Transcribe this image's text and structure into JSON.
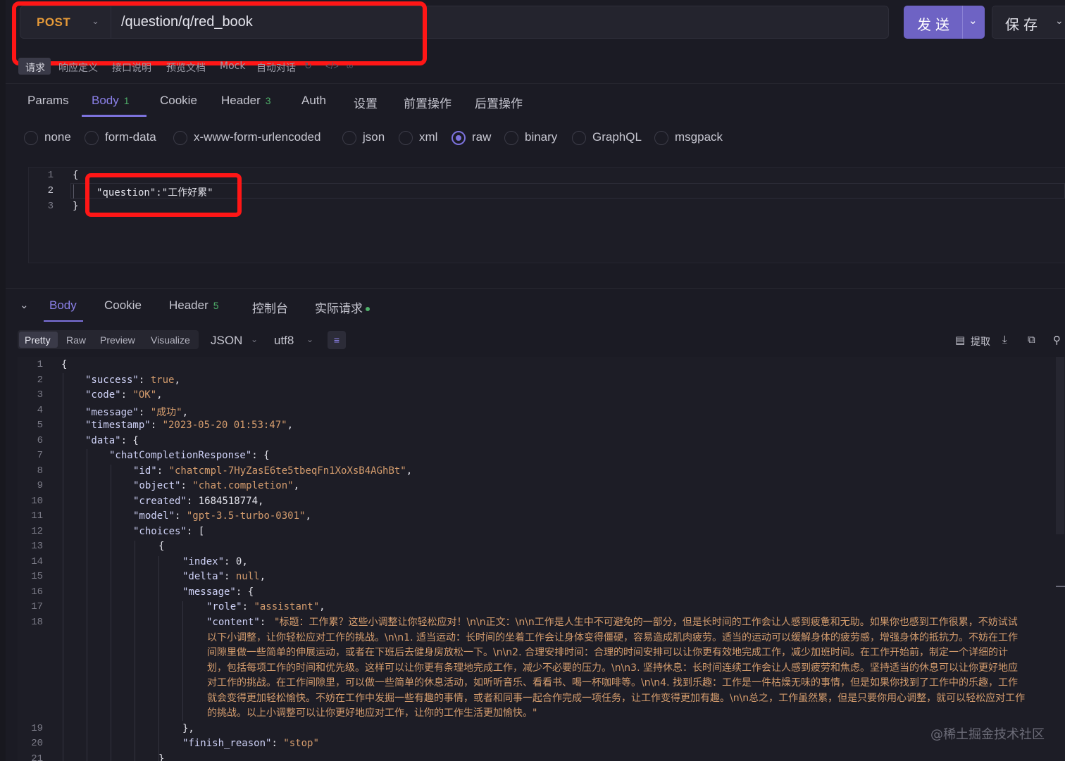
{
  "request": {
    "method": "POST",
    "url": "/question/q/red_book",
    "send_label": "发送",
    "save_label": "保存"
  },
  "sub_tabs": [
    "请求",
    "响应定义",
    "接口说明",
    "预览文档",
    "Mock",
    "自动对话"
  ],
  "request_tabs": [
    {
      "label": "Params",
      "badge": ""
    },
    {
      "label": "Body",
      "badge": "1"
    },
    {
      "label": "Cookie",
      "badge": ""
    },
    {
      "label": "Header",
      "badge": "3"
    },
    {
      "label": "Auth",
      "badge": ""
    },
    {
      "label": "设置",
      "badge": ""
    },
    {
      "label": "前置操作",
      "badge": ""
    },
    {
      "label": "后置操作",
      "badge": ""
    }
  ],
  "body_types": [
    "none",
    "form-data",
    "x-www-form-urlencoded",
    "json",
    "xml",
    "raw",
    "binary",
    "GraphQL",
    "msgpack"
  ],
  "body_type_selected": "raw",
  "request_body_lines": [
    "{",
    "\"question\":\"工作好累\"",
    "}"
  ],
  "response_tabs": [
    {
      "label": "Body",
      "badge": ""
    },
    {
      "label": "Cookie",
      "badge": ""
    },
    {
      "label": "Header",
      "badge": "5"
    },
    {
      "label": "控制台",
      "badge": ""
    },
    {
      "label": "实际请求",
      "badge": ""
    }
  ],
  "view_modes": [
    "Pretty",
    "Raw",
    "Preview",
    "Visualize"
  ],
  "format": "JSON",
  "encoding": "utf8",
  "extract_label": "提取",
  "response": {
    "success": "true",
    "code": "\"OK\"",
    "message": "\"成功\"",
    "timestamp": "\"2023-05-20 01:53:47\"",
    "id": "\"chatcmpl-7HyZasE6te5tbeqFn1XoXsB4AGhBt\"",
    "object": "\"chat.completion\"",
    "created": "1684518774",
    "model": "\"gpt-3.5-turbo-0301\"",
    "index": "0",
    "delta": "null",
    "role": "\"assistant\"",
    "content_lines": [
      "\"标题：工作累？这些小调整让你轻松应对！\\n\\n正文：\\n\\n工作是人生中不可避免的一部分，但是长时间的工作会让人感到疲惫和无助。如果你也感到工作很累，不妨试试",
      "以下小调整，让你轻松应对工作的挑战。\\n\\n1. 适当运动：长时间的坐着工作会让身体变得僵硬，容易造成肌肉疲劳。适当的运动可以缓解身体的疲劳感，增强身体的抵抗力。不妨在工作",
      "间隙里做一些简单的伸展运动，或者在下班后去健身房放松一下。\\n\\n2. 合理安排时间：合理的时间安排可以让你更有效地完成工作，减少加班时间。在工作开始前，制定一个详细的计",
      "划，包括每项工作的时间和优先级。这样可以让你更有条理地完成工作，减少不必要的压力。\\n\\n3. 坚持休息：长时间连续工作会让人感到疲劳和焦虑。坚持适当的休息可以让你更好地应",
      "对工作的挑战。在工作间隙里，可以做一些简单的休息活动，如听听音乐、看看书、喝一杯咖啡等。\\n\\n4. 找到乐趣：工作是一件枯燥无味的事情，但是如果你找到了工作中的乐趣，工作",
      "就会变得更加轻松愉快。不妨在工作中发掘一些有趣的事情，或者和同事一起合作完成一项任务，让工作变得更加有趣。\\n\\n总之，工作虽然累，但是只要你用心调整，就可以轻松应对工作",
      "的挑战。以上小调整可以让你更好地应对工作，让你的工作生活更加愉快。\""
    ],
    "finish_reason": "\"stop\""
  },
  "watermark": "@稀土掘金技术社区",
  "colors": {
    "accent": "#7c72dc",
    "highlight": "#ff1616",
    "method": "#e69a38",
    "string": "#d49c6d"
  }
}
